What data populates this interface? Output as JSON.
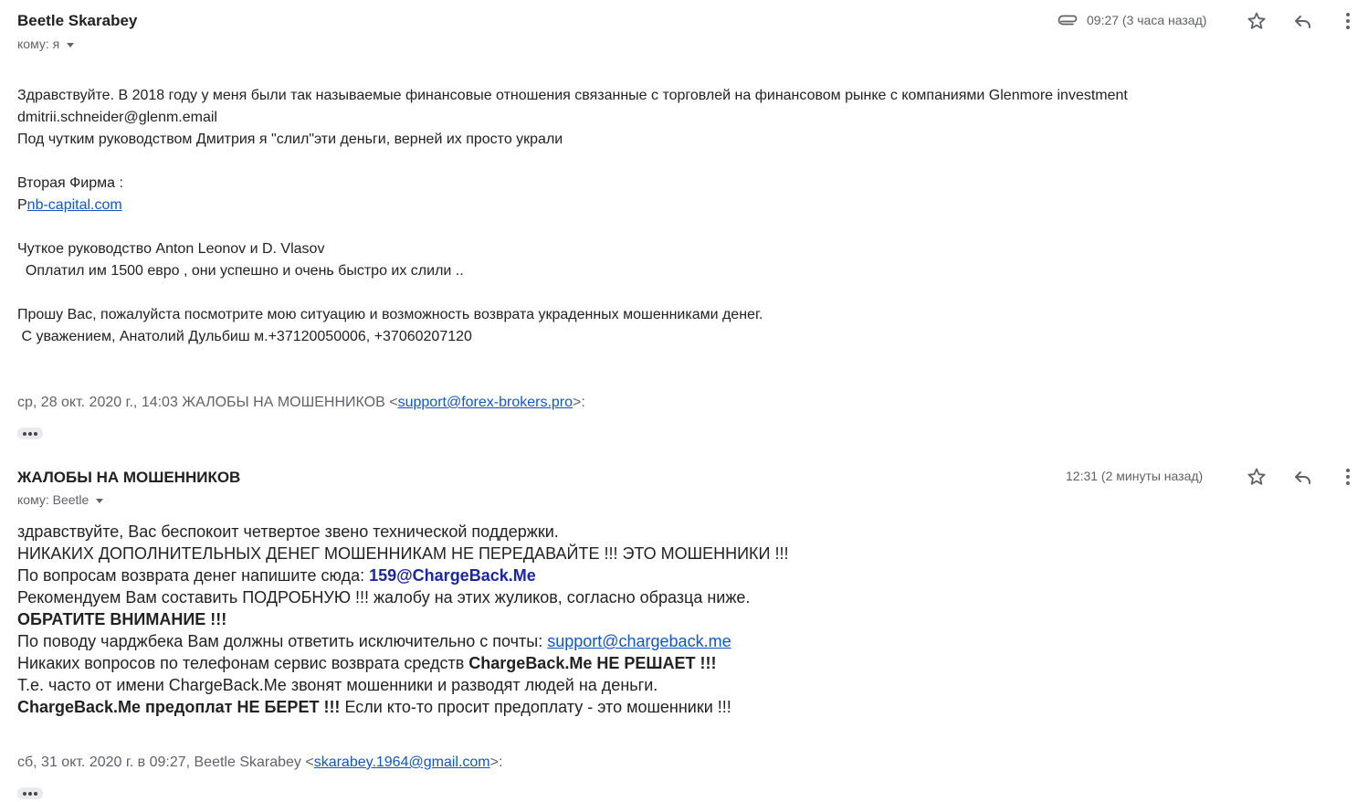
{
  "message1": {
    "sender": "Beetle Skarabey",
    "to_label": "кому: я",
    "time": "09:27 (3 часа назад)",
    "icons": [
      "attachment-icon",
      "star-icon",
      "reply-icon",
      "more-vert-icon"
    ],
    "body": {
      "l1": "Здравствуйте. В 2018 году у меня были так называемые финансовые отношения связанные с торговлей на финансовом рынке с компаниями Glenmore investment",
      "l2": "dmitrii.schneider@glenm.email",
      "l3": "Под чутким руководством Дмитрия я \"слил\"эти деньги, верней их просто украли",
      "l4": "Вторая Фирма :",
      "l5_prefix": "P",
      "l5_link": "nb-capital.com",
      "l6": "Чуткое руководство Anton Leonov и D. Vlasov",
      "l7": "  Оплатил им 1500 евро , они успешно и очень быстро их слили ..",
      "l8": "Прошу Вас, пожалуйста посмотрите мою ситуацию и возможность возврата украденных мошенниками денег.",
      "l9": " С уважением, Анатолий Дульбиш м.+37120050006, +37060207120"
    },
    "quote": {
      "prefix": "ср, 28 окт. 2020 г., 14:03 ЖАЛОБЫ НА МОШЕННИКОВ <",
      "email": "support@forex-brokers.pro",
      "suffix": ">:"
    }
  },
  "message2": {
    "sender": "ЖАЛОБЫ НА МОШЕННИКОВ",
    "to_label": "кому: Beetle",
    "time": "12:31 (2 минуты назад)",
    "icons": [
      "star-icon",
      "reply-icon",
      "more-vert-icon"
    ],
    "body": {
      "l1": "здравствуйте, Вас беспокоит четвертое звено технической поддержки.",
      "l2": "НИКАКИХ ДОПОЛНИТЕЛЬНЫХ ДЕНЕГ МОШЕННИКАМ НЕ ПЕРЕДАВАЙТЕ !!! ЭТО МОШЕННИКИ !!!",
      "l3_prefix": "По вопросам возврата денег напишите сюда: ",
      "l3_link": "159@ChargeBack.Me",
      "l4": "Рекомендуем Вам составить ПОДРОБНУЮ !!! жалобу на этих жуликов, согласно образца ниже.",
      "l5": "ОБРАТИТЕ ВНИМАНИЕ !!!",
      "l6_prefix": "По поводу чарджбека Вам должны ответить исключительно с почты: ",
      "l6_link": "support@chargeback.me",
      "l7_prefix": "Никаких вопросов по телефонам сервис возврата средств ",
      "l7_bold": "ChargeBack.Me НЕ РЕШАЕТ !!!",
      "l8": "Т.е. часто от имени ChargeBack.Me звонят мошенники и разводят людей на деньги.",
      "l9_bold": "ChargeBack.Me предоплат НЕ БЕРЕТ !!!",
      "l9_suffix": " Если кто-то просит предоплату - это мошенники !!!"
    },
    "quote": {
      "prefix": "сб, 31 окт. 2020 г. в 09:27, Beetle Skarabey <",
      "email": "skarabey.1964@gmail.com",
      "suffix": ">:"
    }
  }
}
